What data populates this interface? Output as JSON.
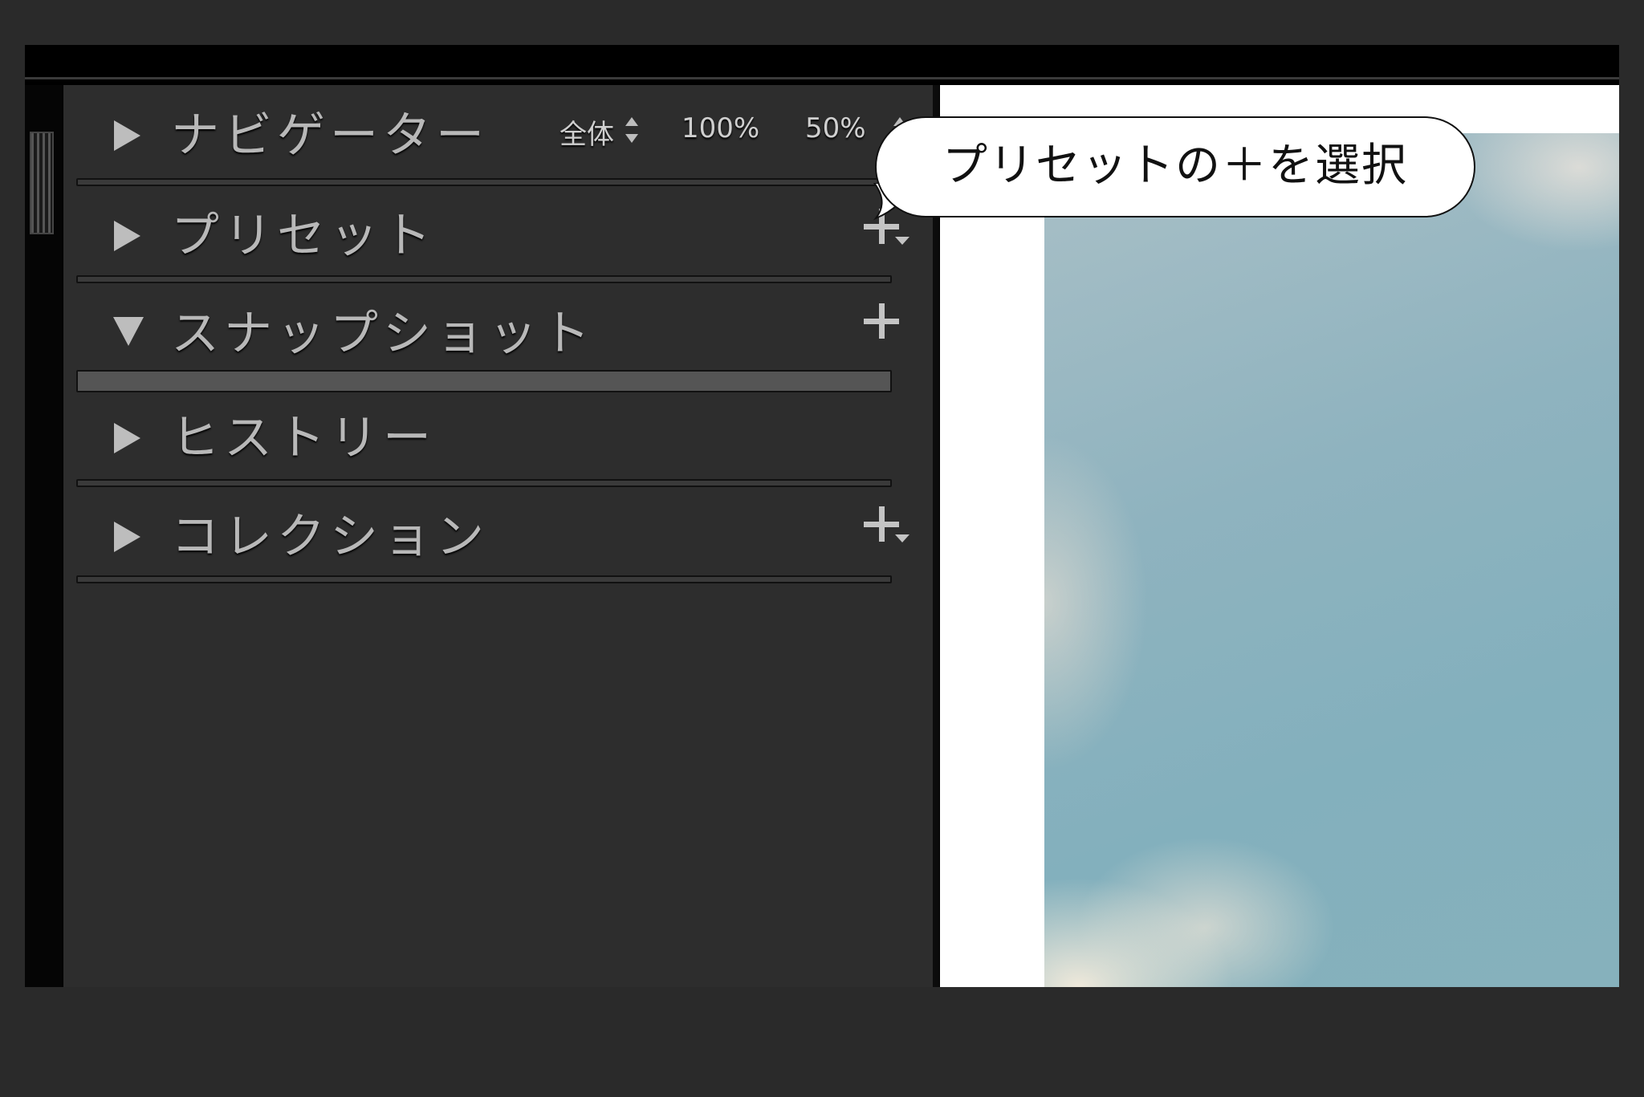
{
  "panel": {
    "sections": [
      {
        "title": "ナビゲーター",
        "state": "collapsed"
      },
      {
        "title": "プリセット",
        "state": "collapsed"
      },
      {
        "title": "スナップショット",
        "state": "expanded"
      },
      {
        "title": "ヒストリー",
        "state": "collapsed"
      },
      {
        "title": "コレクション",
        "state": "collapsed"
      }
    ],
    "navigator_zoom": {
      "fit_label": "全体",
      "opt_100": "100%",
      "opt_50": "50%"
    }
  },
  "callout": {
    "text": "プリセットの＋を選択"
  },
  "icons": {
    "expand": "triangle-right-icon",
    "collapse": "triangle-down-icon",
    "add": "plus-icon",
    "add_menu": "plus-dropdown-icon"
  },
  "colors": {
    "panel_bg": "#2d2d2d",
    "text": "#b8b8b8",
    "sky": "#86b1bc"
  }
}
